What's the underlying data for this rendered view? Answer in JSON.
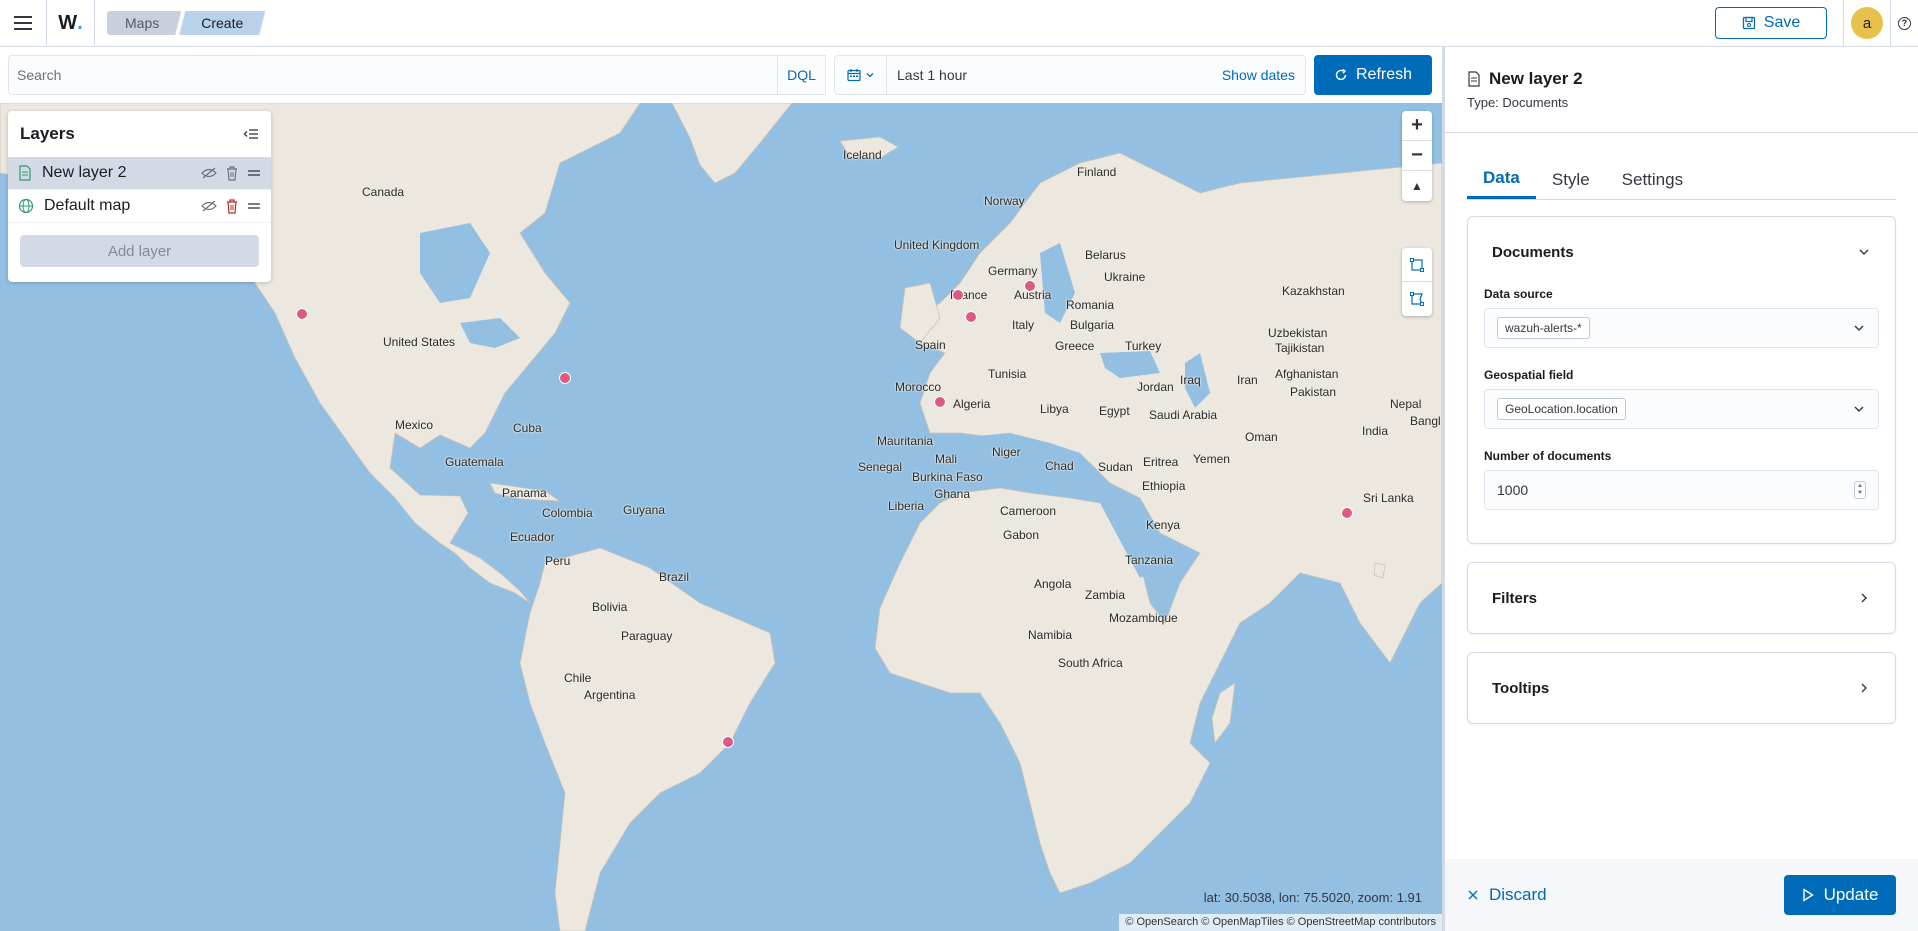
{
  "header": {
    "logo_text": "W",
    "breadcrumbs": [
      "Maps",
      "Create"
    ],
    "save_label": "Save",
    "avatar_initial": "a",
    "help_label": "?"
  },
  "querybar": {
    "search_placeholder": "Search",
    "dql_label": "DQL",
    "time_range": "Last 1 hour",
    "show_dates_label": "Show dates",
    "refresh_label": "Refresh"
  },
  "layers_panel": {
    "title": "Layers",
    "items": [
      {
        "name": "New layer 2",
        "icon": "document-icon",
        "selected": true
      },
      {
        "name": "Default map",
        "icon": "globe-icon",
        "selected": false
      }
    ],
    "add_layer_label": "Add layer"
  },
  "map": {
    "labels": [
      {
        "text": "Iceland"
      },
      {
        "text": "Finland"
      },
      {
        "text": "Norway"
      },
      {
        "text": "Canada"
      },
      {
        "text": "United Kingdom"
      },
      {
        "text": "Belarus"
      },
      {
        "text": "Germany"
      },
      {
        "text": "Ukraine"
      },
      {
        "text": "Kazakhstan"
      },
      {
        "text": "France"
      },
      {
        "text": "Austria"
      },
      {
        "text": "Romania"
      },
      {
        "text": "Italy"
      },
      {
        "text": "Bulgaria"
      },
      {
        "text": "Uzbekistan"
      },
      {
        "text": "Tajikistan"
      },
      {
        "text": "United States"
      },
      {
        "text": "Spain"
      },
      {
        "text": "Greece"
      },
      {
        "text": "Turkey"
      },
      {
        "text": "Tunisia"
      },
      {
        "text": "Afghanistan"
      },
      {
        "text": "Iraq"
      },
      {
        "text": "Iran"
      },
      {
        "text": "Jordan"
      },
      {
        "text": "Morocco"
      },
      {
        "text": "Pakistan"
      },
      {
        "text": "Nepal"
      },
      {
        "text": "Algeria"
      },
      {
        "text": "Libya"
      },
      {
        "text": "Egypt"
      },
      {
        "text": "Saudi Arabia"
      },
      {
        "text": "Mexico"
      },
      {
        "text": "Cuba"
      },
      {
        "text": "India"
      },
      {
        "text": "Bangl"
      },
      {
        "text": "Oman"
      },
      {
        "text": "Mauritania"
      },
      {
        "text": "Niger"
      },
      {
        "text": "Mali"
      },
      {
        "text": "Guatemala"
      },
      {
        "text": "Chad"
      },
      {
        "text": "Sudan"
      },
      {
        "text": "Eritrea"
      },
      {
        "text": "Yemen"
      },
      {
        "text": "Senegal"
      },
      {
        "text": "Burkina Faso"
      },
      {
        "text": "Ethiopia"
      },
      {
        "text": "Ghana"
      },
      {
        "text": "Panama"
      },
      {
        "text": "Liberia"
      },
      {
        "text": "Sri Lanka"
      },
      {
        "text": "Cameroon"
      },
      {
        "text": "Colombia"
      },
      {
        "text": "Guyana"
      },
      {
        "text": "Kenya"
      },
      {
        "text": "Ecuador"
      },
      {
        "text": "Gabon"
      },
      {
        "text": "Tanzania"
      },
      {
        "text": "Peru"
      },
      {
        "text": "Brazil"
      },
      {
        "text": "Angola"
      },
      {
        "text": "Zambia"
      },
      {
        "text": "Bolivia"
      },
      {
        "text": "Mozambique"
      },
      {
        "text": "Paraguay"
      },
      {
        "text": "Namibia"
      },
      {
        "text": "South Africa"
      },
      {
        "text": "Chile"
      },
      {
        "text": "Argentina"
      }
    ],
    "coordinates_readout": "lat: 30.5038, lon: 75.5020, zoom: 1.91",
    "attribution": "© OpenSearch © OpenMapTiles © OpenStreetMap contributors",
    "marker_color": "#dc5a84",
    "zoom_in_label": "+",
    "zoom_out_label": "−",
    "compass_label": "▲"
  },
  "config_panel": {
    "layer_title": "New layer 2",
    "layer_type": "Type: Documents",
    "tabs": [
      "Data",
      "Style",
      "Settings"
    ],
    "active_tab": "Data",
    "documents_section": {
      "title": "Documents",
      "data_source_label": "Data source",
      "data_source_value": "wazuh-alerts-*",
      "geo_field_label": "Geospatial field",
      "geo_field_value": "GeoLocation.location",
      "num_docs_label": "Number of documents",
      "num_docs_value": "1000"
    },
    "filters_title": "Filters",
    "tooltips_title": "Tooltips",
    "discard_label": "Discard",
    "update_label": "Update"
  },
  "colors": {
    "accent": "#006bb8",
    "water": "#93bfe2",
    "land": "#ece8df"
  }
}
